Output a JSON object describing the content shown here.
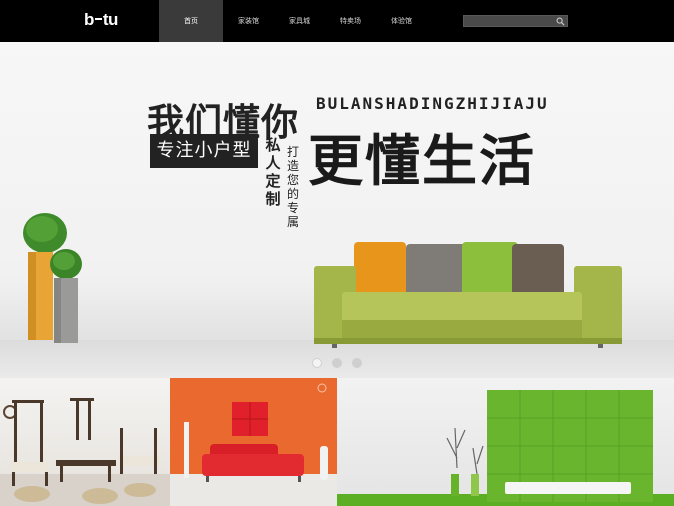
{
  "header": {
    "logo": {
      "left": "b",
      "right": "tu"
    },
    "nav": [
      {
        "label": "首页",
        "active": true
      },
      {
        "label": "家装馆",
        "active": false
      },
      {
        "label": "家具城",
        "active": false
      },
      {
        "label": "特卖场",
        "active": false
      },
      {
        "label": "体验馆",
        "active": false
      }
    ],
    "search": {
      "placeholder": "",
      "value": ""
    }
  },
  "hero": {
    "headline_left": "我们懂你",
    "headline_pinyin": "BULANSHADINGZHIJIAJU",
    "headline_right": "更懂生活",
    "tag": "专注小户型",
    "vertical_1": "私人定制",
    "vertical_2": "打造您的专属",
    "slides": 3,
    "active_slide": 0
  },
  "colors": {
    "header_bg": "#000000",
    "sofa": "#a4b54a",
    "cushion_orange": "#e8951c",
    "cushion_grey": "#7f7c77",
    "cushion_green": "#8cbf3c",
    "cushion_brown": "#6a5d52",
    "thumb2_bg": "#e9692e",
    "thumb3_green": "#69b52e"
  }
}
